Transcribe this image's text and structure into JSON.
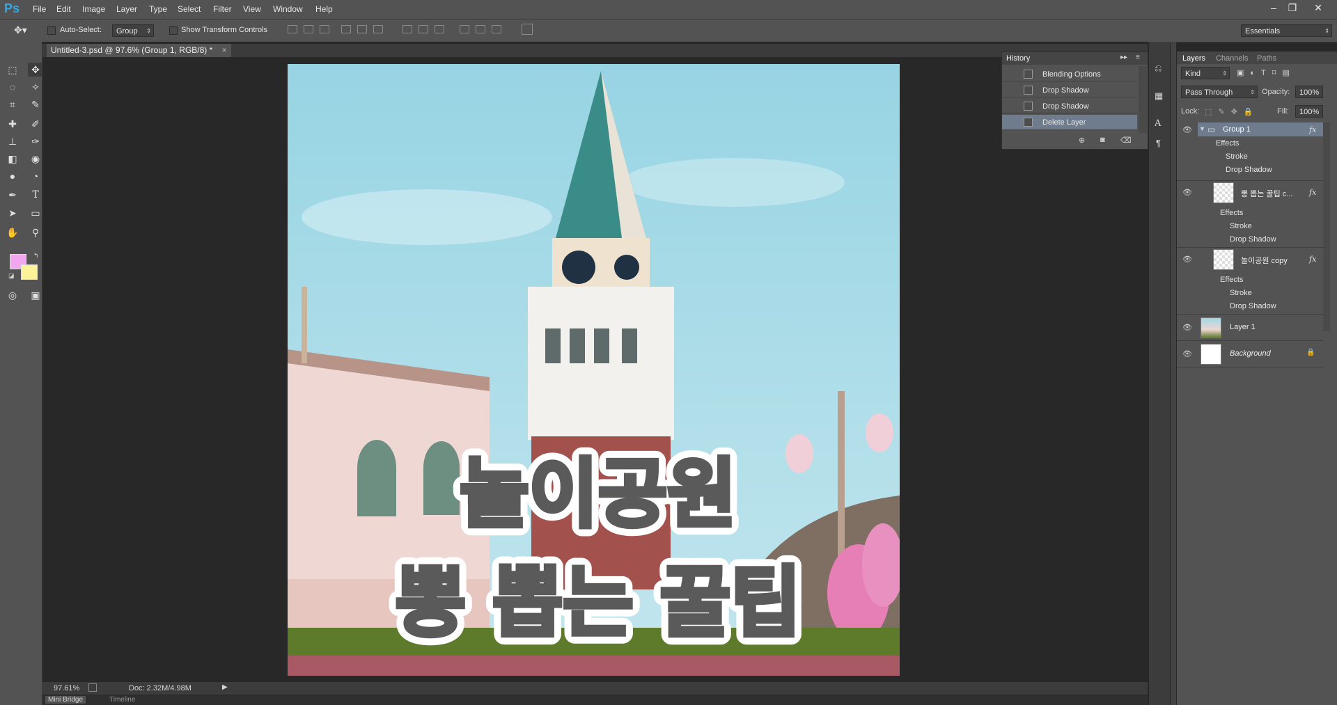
{
  "app": {
    "logo": "Ps"
  },
  "menu": [
    "File",
    "Edit",
    "Image",
    "Layer",
    "Type",
    "Select",
    "Filter",
    "View",
    "Window",
    "Help"
  ],
  "window_controls": {
    "minimize": "–",
    "restore": "❐",
    "close": "✕"
  },
  "options": {
    "auto_select_label": "Auto-Select:",
    "auto_select_value": "Group",
    "show_transform_label": "Show Transform Controls",
    "workspace": "Essentials"
  },
  "document": {
    "tab_title": "Untitled-3.psd @ 97.6% (Group 1, RGB/8) *",
    "tab_close": "×",
    "zoom": "97.61%",
    "doc_info": "Doc: 2.32M/4.98M",
    "overlay_line1": "놀이공원",
    "overlay_line2": "뽕 뽑는 꿀팁"
  },
  "bottom_tabs": [
    "Mini Bridge",
    "Timeline"
  ],
  "colors": {
    "foreground": "#f2a6f0",
    "background": "#fbf29a",
    "text_yellow": "#fafaa0",
    "text_pink": "#e89ae8",
    "selection": "#6f7c8e"
  },
  "history": {
    "title": "History",
    "items": [
      {
        "label": "Blending Options",
        "selected": false
      },
      {
        "label": "Drop Shadow",
        "selected": false
      },
      {
        "label": "Drop Shadow",
        "selected": false
      },
      {
        "label": "Delete Layer",
        "selected": true
      }
    ]
  },
  "layers_panel": {
    "tabs": [
      "Layers",
      "Channels",
      "Paths"
    ],
    "kind_filter": "Kind",
    "blend_mode": "Pass Through",
    "opacity_label": "Opacity:",
    "opacity": "100%",
    "lock_label": "Lock:",
    "fill_label": "Fill:",
    "fill": "100%",
    "fx": "fx",
    "layers": [
      {
        "name": "Group 1",
        "type": "group",
        "effects_label": "Effects",
        "effects": [
          "Stroke",
          "Drop Shadow"
        ]
      },
      {
        "name": "뽕 뽑는 꿀팁 c...",
        "type": "text",
        "effects_label": "Effects",
        "effects": [
          "Stroke",
          "Drop Shadow"
        ]
      },
      {
        "name": "놀이공원 copy",
        "type": "text",
        "effects_label": "Effects",
        "effects": [
          "Stroke",
          "Drop Shadow"
        ]
      },
      {
        "name": "Layer 1",
        "type": "image"
      },
      {
        "name": "Background",
        "type": "background"
      }
    ]
  },
  "icons": [
    "move-tool-icon",
    "marquee-icon",
    "lasso-icon",
    "magic-wand-icon",
    "crop-icon",
    "eyedropper-icon",
    "healing-brush-icon",
    "brush-icon",
    "clone-stamp-icon",
    "history-brush-icon",
    "eraser-icon",
    "paint-bucket-icon",
    "blur-icon",
    "dodge-icon",
    "pen-icon",
    "type-icon",
    "path-select-icon",
    "rectangle-icon",
    "hand-icon",
    "zoom-icon",
    "eye-icon",
    "lock-icon",
    "folder-icon"
  ]
}
